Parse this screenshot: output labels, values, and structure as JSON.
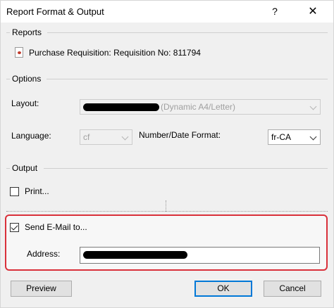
{
  "window": {
    "title": "Report Format & Output",
    "help_glyph": "?",
    "close_glyph": "✕"
  },
  "reports": {
    "section_label": "Reports",
    "item_label": "Purchase Requisition: Requisition No: 811794",
    "item_icon": "report-document-icon"
  },
  "options": {
    "section_label": "Options",
    "layout_label": "Layout:",
    "layout_value_suffix": "(Dynamic A4/Letter)",
    "language_label": "Language:",
    "language_value": "cf",
    "number_date_label": "Number/Date Format:",
    "number_date_value": "fr-CA"
  },
  "output": {
    "section_label": "Output",
    "print_label": "Print...",
    "print_checked": false,
    "email_label": "Send E-Mail to...",
    "email_checked": true,
    "address_label": "Address:"
  },
  "buttons": {
    "preview": "Preview",
    "ok": "OK",
    "cancel": "Cancel"
  },
  "colors": {
    "highlight": "#d9303a",
    "default_button_border": "#0078d7"
  }
}
